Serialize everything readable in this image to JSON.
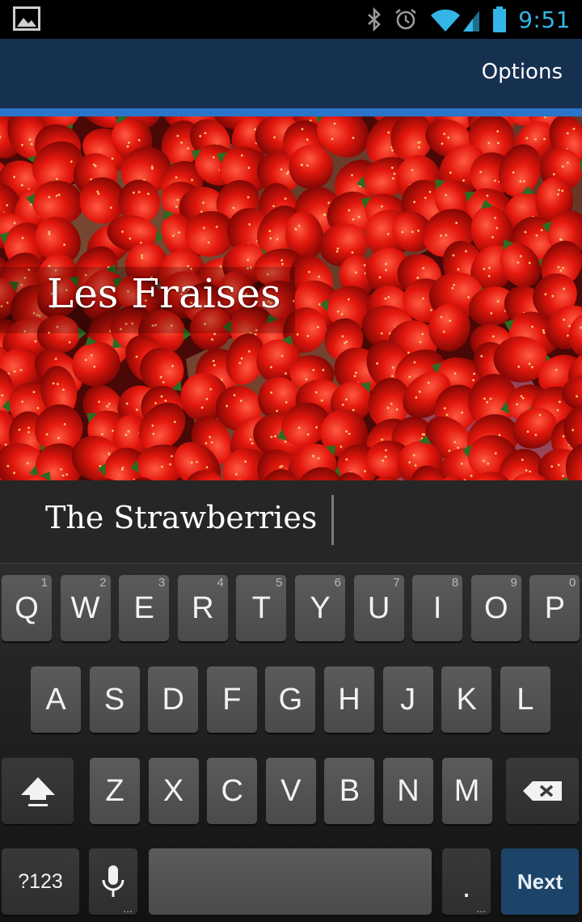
{
  "status_bar": {
    "time": "9:51",
    "icons": [
      "gallery-notification-icon",
      "bluetooth-icon",
      "alarm-icon",
      "wifi-icon",
      "signal-icon",
      "battery-icon"
    ],
    "accent_color": "#33b5e5"
  },
  "action_bar": {
    "options_label": "Options",
    "background_color": "#16314f",
    "accent_line_color": "#2a74c9"
  },
  "hero": {
    "title": "Les Fraises",
    "image_subject": "strawberries-photo"
  },
  "subtitle_field": {
    "value": "The Strawberries"
  },
  "keyboard": {
    "row1": [
      {
        "label": "Q",
        "hint": "1"
      },
      {
        "label": "W",
        "hint": "2"
      },
      {
        "label": "E",
        "hint": "3"
      },
      {
        "label": "R",
        "hint": "4"
      },
      {
        "label": "T",
        "hint": "5"
      },
      {
        "label": "Y",
        "hint": "6"
      },
      {
        "label": "U",
        "hint": "7"
      },
      {
        "label": "I",
        "hint": "8"
      },
      {
        "label": "O",
        "hint": "9"
      },
      {
        "label": "P",
        "hint": "0"
      }
    ],
    "row2": [
      "A",
      "S",
      "D",
      "F",
      "G",
      "H",
      "J",
      "K",
      "L"
    ],
    "row3": [
      "Z",
      "X",
      "C",
      "V",
      "B",
      "N",
      "M"
    ],
    "symbols_label": "?123",
    "period_label": ".",
    "next_label": "Next",
    "next_color": "#1b4468"
  }
}
